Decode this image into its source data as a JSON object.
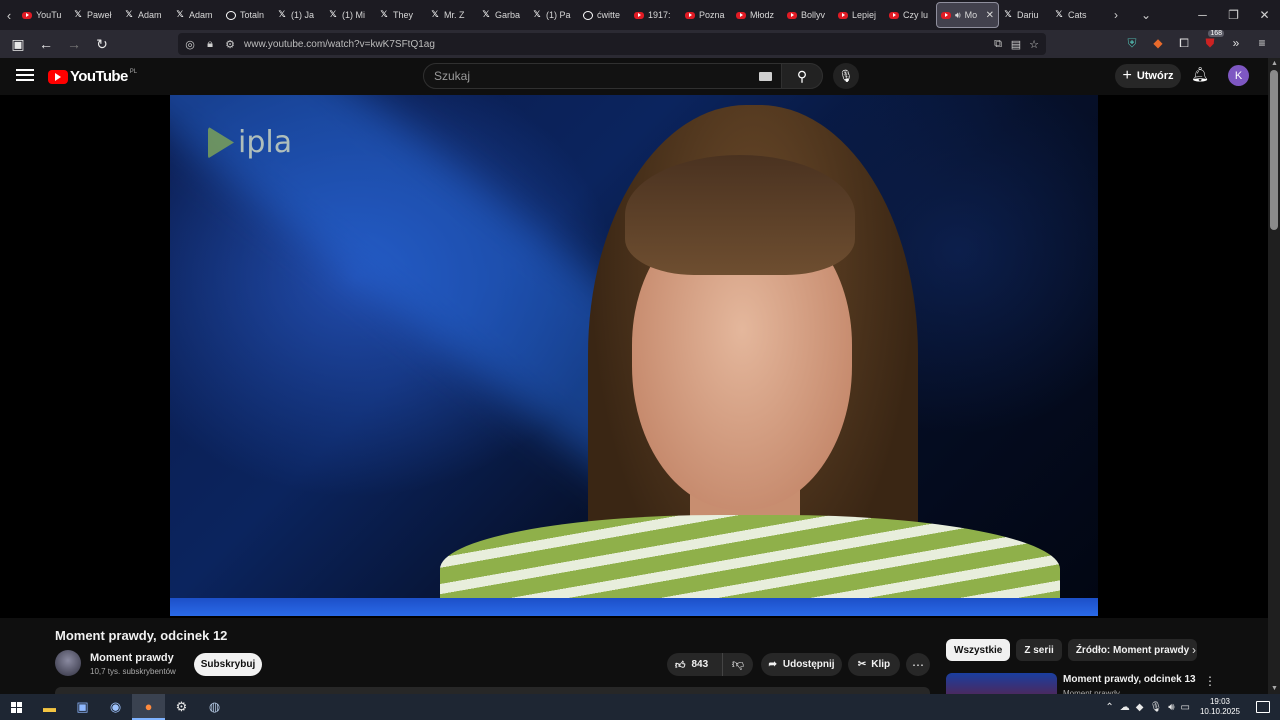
{
  "browser": {
    "tabs": [
      {
        "label": "YouTu",
        "icon": "youtube"
      },
      {
        "label": "Paweł",
        "icon": "x"
      },
      {
        "label": "Adam",
        "icon": "x"
      },
      {
        "label": "Adam",
        "icon": "x"
      },
      {
        "label": "Totaln",
        "icon": "threads"
      },
      {
        "label": "(1) Ja",
        "icon": "x"
      },
      {
        "label": "(1) Mi",
        "icon": "x"
      },
      {
        "label": "They",
        "icon": "x"
      },
      {
        "label": "Mr. Z",
        "icon": "x"
      },
      {
        "label": "Garba",
        "icon": "x"
      },
      {
        "label": "(1) Pa",
        "icon": "x"
      },
      {
        "label": "ćwitte",
        "icon": "threads"
      },
      {
        "label": "1917:",
        "icon": "youtube"
      },
      {
        "label": "Pozna",
        "icon": "youtube"
      },
      {
        "label": "Młodz",
        "icon": "youtube"
      },
      {
        "label": "Bollyv",
        "icon": "youtube"
      },
      {
        "label": "Lepiej",
        "icon": "youtube"
      },
      {
        "label": "Czy lu",
        "icon": "youtube"
      },
      {
        "label": "Mo",
        "icon": "youtube",
        "active": true
      },
      {
        "label": "Dariu",
        "icon": "x"
      },
      {
        "label": "Cats",
        "icon": "x"
      }
    ],
    "url": "www.youtube.com/watch?v=kwK7SFtQ1ag",
    "extension_badge": "168"
  },
  "youtube": {
    "logo_text": "YouTube",
    "country_code": "PL",
    "search_placeholder": "Szukaj",
    "create_label": "Utwórz",
    "avatar_letter": "K",
    "video_watermark": "ipla",
    "video_title": "Moment prawdy, odcinek 12",
    "channel_name": "Moment prawdy",
    "channel_subs": "10,7 tys. subskrybentów",
    "subscribe_label": "Subskrybuj",
    "like_count": "843",
    "share_label": "Udostępnij",
    "clip_label": "Klip",
    "chips": [
      "Wszystkie",
      "Z serii",
      "Źródło: Moment prawdy"
    ],
    "recommendation": {
      "title": "Moment prawdy, odcinek 13",
      "channel": "Moment prawdy"
    }
  },
  "taskbar": {
    "time": "19:03",
    "date": "10.10.2025"
  },
  "colors": {
    "youtube_red": "#ff0000",
    "avatar_purple": "#7e57c2",
    "page_bg": "#0f0f0f"
  }
}
